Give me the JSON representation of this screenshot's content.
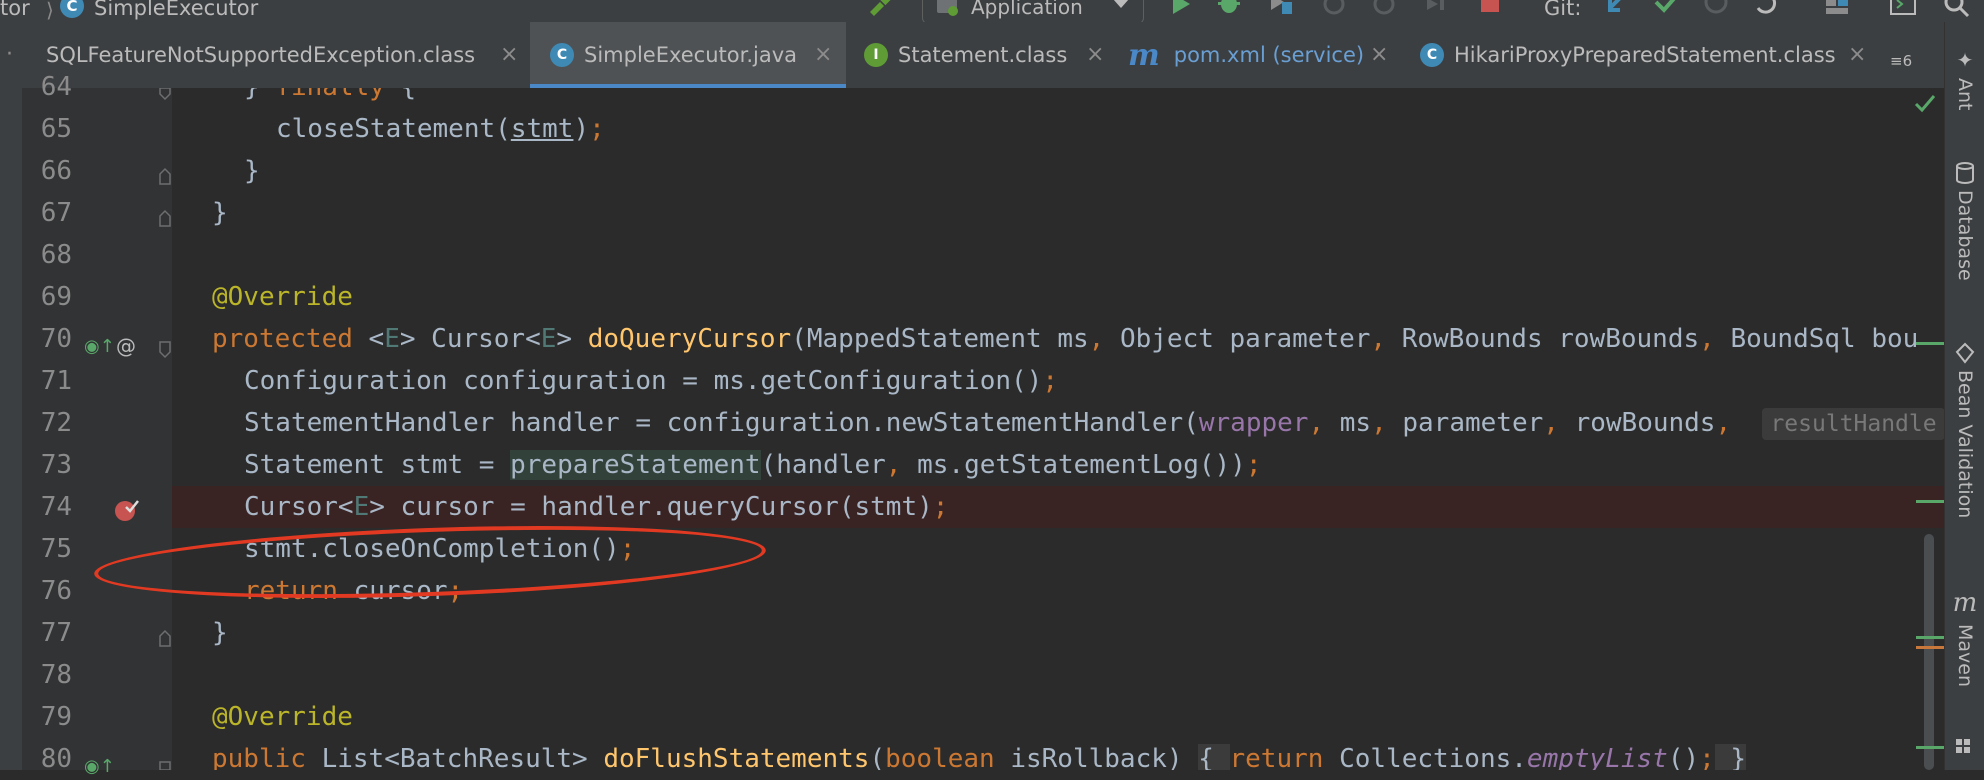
{
  "breadcrumb": {
    "prefix": "tor",
    "class_name": "SimpleExecutor"
  },
  "toolbar": {
    "run_config": "Application",
    "git_label": "Git:"
  },
  "tabs": [
    {
      "label": "SQLFeatureNotSupportedException.class",
      "icon": "class-icon"
    },
    {
      "label": "SimpleExecutor.java",
      "icon": "class-icon",
      "active": true
    },
    {
      "label": "Statement.class",
      "icon": "interface-icon"
    },
    {
      "label": "pom.xml (service)",
      "icon": "maven-icon"
    },
    {
      "label": "HikariProxyPreparedStatement.class",
      "icon": "class-icon"
    }
  ],
  "tab_overflow": "≡6",
  "line_numbers": [
    "64",
    "65",
    "66",
    "67",
    "68",
    "69",
    "70",
    "71",
    "72",
    "73",
    "74",
    "75",
    "76",
    "77",
    "78",
    "79",
    "80"
  ],
  "code": {
    "l64_a": "} ",
    "l64_b": "finally",
    "l64_c": " {",
    "l65_a": "closeStatement(",
    "l65_b": "stmt",
    "l65_c": ")",
    "l65_d": ";",
    "l66": "}",
    "l67": "}",
    "l69": "@Override",
    "l70_kw": "protected",
    "l70_a": " <",
    "l70_b": "E",
    "l70_c": "> Cursor<",
    "l70_d": "E",
    "l70_e": "> ",
    "l70_fn": "doQueryCursor",
    "l70_f": "(MappedStatement ms",
    "l70_g": ",",
    "l70_h": " Object parameter",
    "l70_i": ",",
    "l70_j": " RowBounds rowBounds",
    "l70_k": ",",
    "l70_l": " BoundSql bou",
    "l71_a": "Configuration configuration = ms.getConfiguration()",
    "l71_b": ";",
    "l72_a": "StatementHandler handler = configuration.newStatementHandler(",
    "l72_b": "wrapper",
    "l72_c": ",",
    "l72_d": " ms",
    "l72_e": ",",
    "l72_f": " parameter",
    "l72_g": ",",
    "l72_h": " rowBounds",
    "l72_i": ",",
    "l72_hint": "resultHandle",
    "l73_a": "Statement stmt = ",
    "l73_b": "prepareStatement",
    "l73_c": "(handler",
    "l73_d": ",",
    "l73_e": " ms.getStatementLog())",
    "l73_f": ";",
    "l74_a": "Cursor<",
    "l74_b": "E",
    "l74_c": "> cursor = handler.queryCursor(stmt)",
    "l74_d": ";",
    "l75_a": "stmt.closeOnCompletion()",
    "l75_b": ";",
    "l76_kw": "return",
    "l76_a": " cursor",
    "l76_b": ";",
    "l77": "}",
    "l79": "@Override",
    "l80_kw": "public",
    "l80_a": " List<BatchResult> ",
    "l80_fn": "doFlushStatements",
    "l80_b": "(",
    "l80_kw2": "boolean",
    "l80_c": " isRollback) ",
    "l80_d": "{ ",
    "l80_kw3": "return",
    "l80_e": " Collections.",
    "l80_f": "emptyList",
    "l80_g": "()",
    "l80_h": ";",
    "l80_i": " }"
  },
  "right_tools": [
    {
      "label": "Ant",
      "icon": "ant-icon"
    },
    {
      "label": "Database",
      "icon": "database-icon"
    },
    {
      "label": "Bean Validation",
      "icon": "bean-validation-icon"
    },
    {
      "label": "Maven",
      "icon": "maven-icon"
    }
  ],
  "colors": {
    "accent": "#4a88c7",
    "keyword": "#cc7832",
    "annotation": "#bbb529",
    "method": "#ffc66d",
    "field": "#9876aa",
    "breakpoint": "#c75450",
    "annotation_oval": "#e23a22"
  }
}
